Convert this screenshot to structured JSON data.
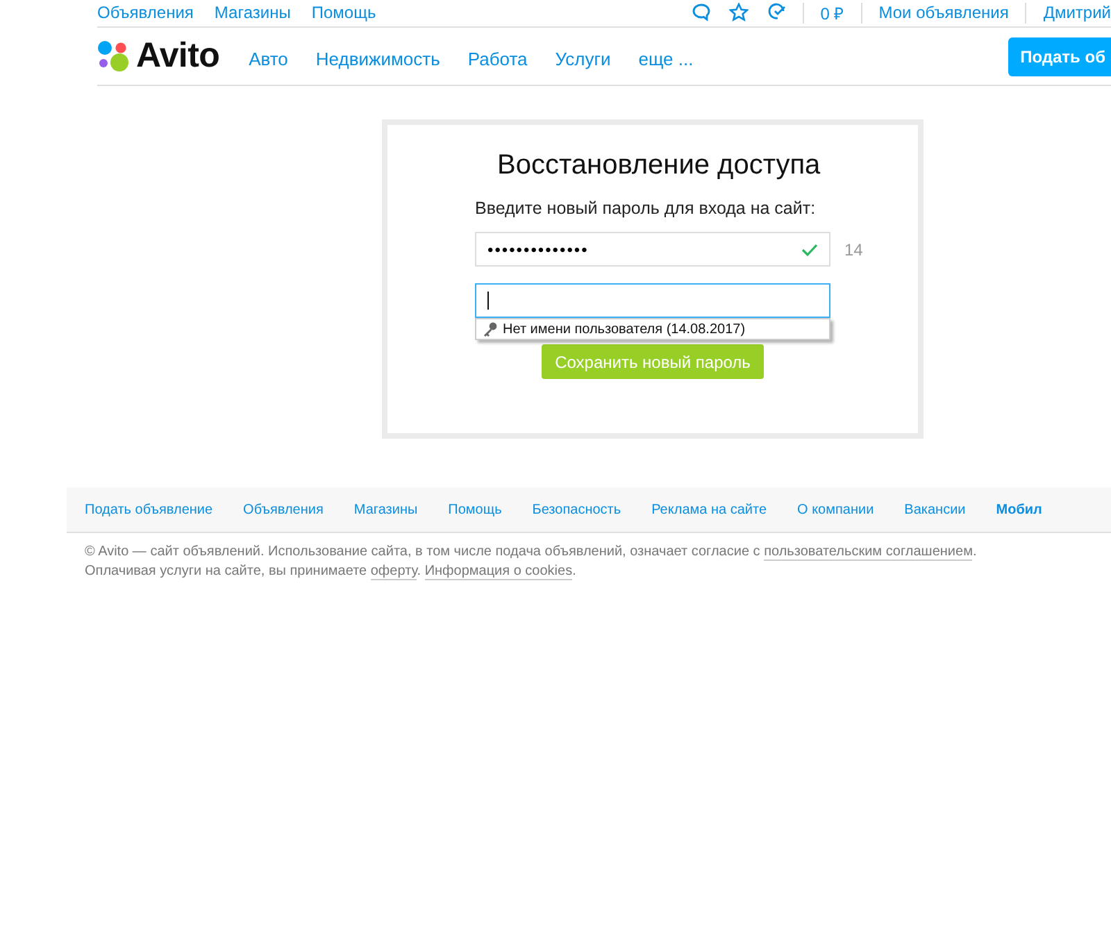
{
  "top_links": [
    "Объявления",
    "Магазины",
    "Помощь"
  ],
  "top_right": {
    "balance": "0 ₽",
    "my_ads": "Мои объявления",
    "user": "Дмитрий"
  },
  "logo": {
    "text": "Avito"
  },
  "nav": [
    "Авто",
    "Недвижимость",
    "Работа",
    "Услуги",
    "еще ..."
  ],
  "post_button": "Подать об",
  "card": {
    "title": "Восстановление доступа",
    "label": "Введите новый пароль для входа на сайт:",
    "password": {
      "value": "••••••••••••••",
      "valid": true,
      "count": "14"
    },
    "confirm": {
      "focused": true
    },
    "autocomplete": {
      "text": "Нет имени пользователя (14.08.2017)"
    },
    "submit": "Сохранить новый пароль"
  },
  "footer_links": [
    {
      "label": "Подать объявление",
      "bold": false
    },
    {
      "label": "Объявления",
      "bold": false
    },
    {
      "label": "Магазины",
      "bold": false
    },
    {
      "label": "Помощь",
      "bold": false
    },
    {
      "label": "Безопасность",
      "bold": false
    },
    {
      "label": "Реклама на сайте",
      "bold": false
    },
    {
      "label": "О компании",
      "bold": false
    },
    {
      "label": "Вакансии",
      "bold": false
    },
    {
      "label": "Мобил",
      "bold": true
    }
  ],
  "legal": [
    [
      {
        "kind": "text",
        "text": "© Avito — сайт объявлений. Использование сайта, в том числе подача объявлений, означает согласие с "
      },
      {
        "kind": "link",
        "text": "пользовательским соглашением"
      },
      {
        "kind": "text",
        "text": "."
      }
    ],
    [
      {
        "kind": "text",
        "text": "Оплачивая услуги на сайте, вы принимаете "
      },
      {
        "kind": "link",
        "text": "оферту"
      },
      {
        "kind": "text",
        "text": ". "
      },
      {
        "kind": "link",
        "text": "Информация о cookies"
      },
      {
        "kind": "text",
        "text": "."
      }
    ]
  ]
}
